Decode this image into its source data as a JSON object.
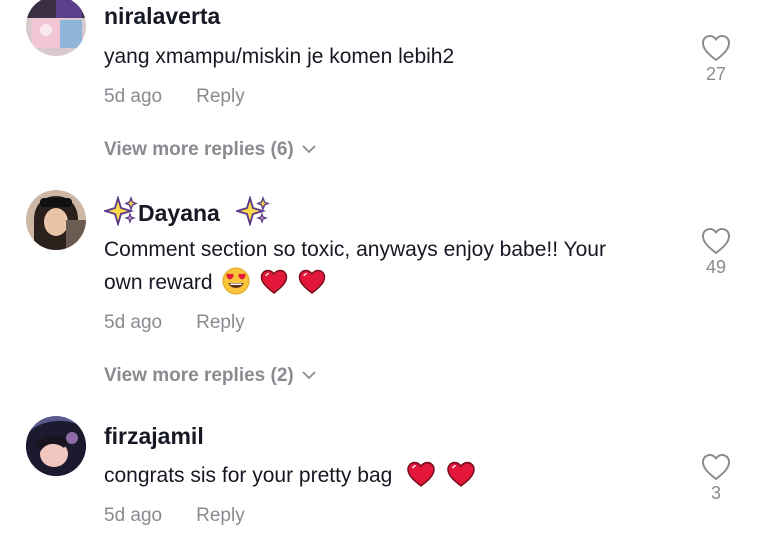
{
  "comments": [
    {
      "username": "niralaverta",
      "text": "yang xmampu/miskin je komen lebih2",
      "time": "5d ago",
      "reply_label": "Reply",
      "likes": "27",
      "more_replies": "View more replies (6)"
    },
    {
      "username": "Dayana",
      "text_line1": "Comment section so toxic, anyways enjoy babe!! Your",
      "text_line2": "own reward",
      "time": "5d ago",
      "reply_label": "Reply",
      "likes": "49",
      "more_replies": "View more replies (2)"
    },
    {
      "username": "firzajamil",
      "text": "congrats sis for your pretty bag",
      "time": "5d ago",
      "reply_label": "Reply",
      "likes": "3"
    }
  ],
  "icons": {
    "like": "heart-outline-icon",
    "expand": "chevron-down-icon",
    "emoji_heart_eyes": "heart-eyes-emoji",
    "emoji_heart": "red-heart-emoji",
    "emoji_sparkles": "sparkles-emoji"
  },
  "colors": {
    "text": "#161823",
    "muted": "#8a8b91",
    "heart": "#e3173a"
  }
}
